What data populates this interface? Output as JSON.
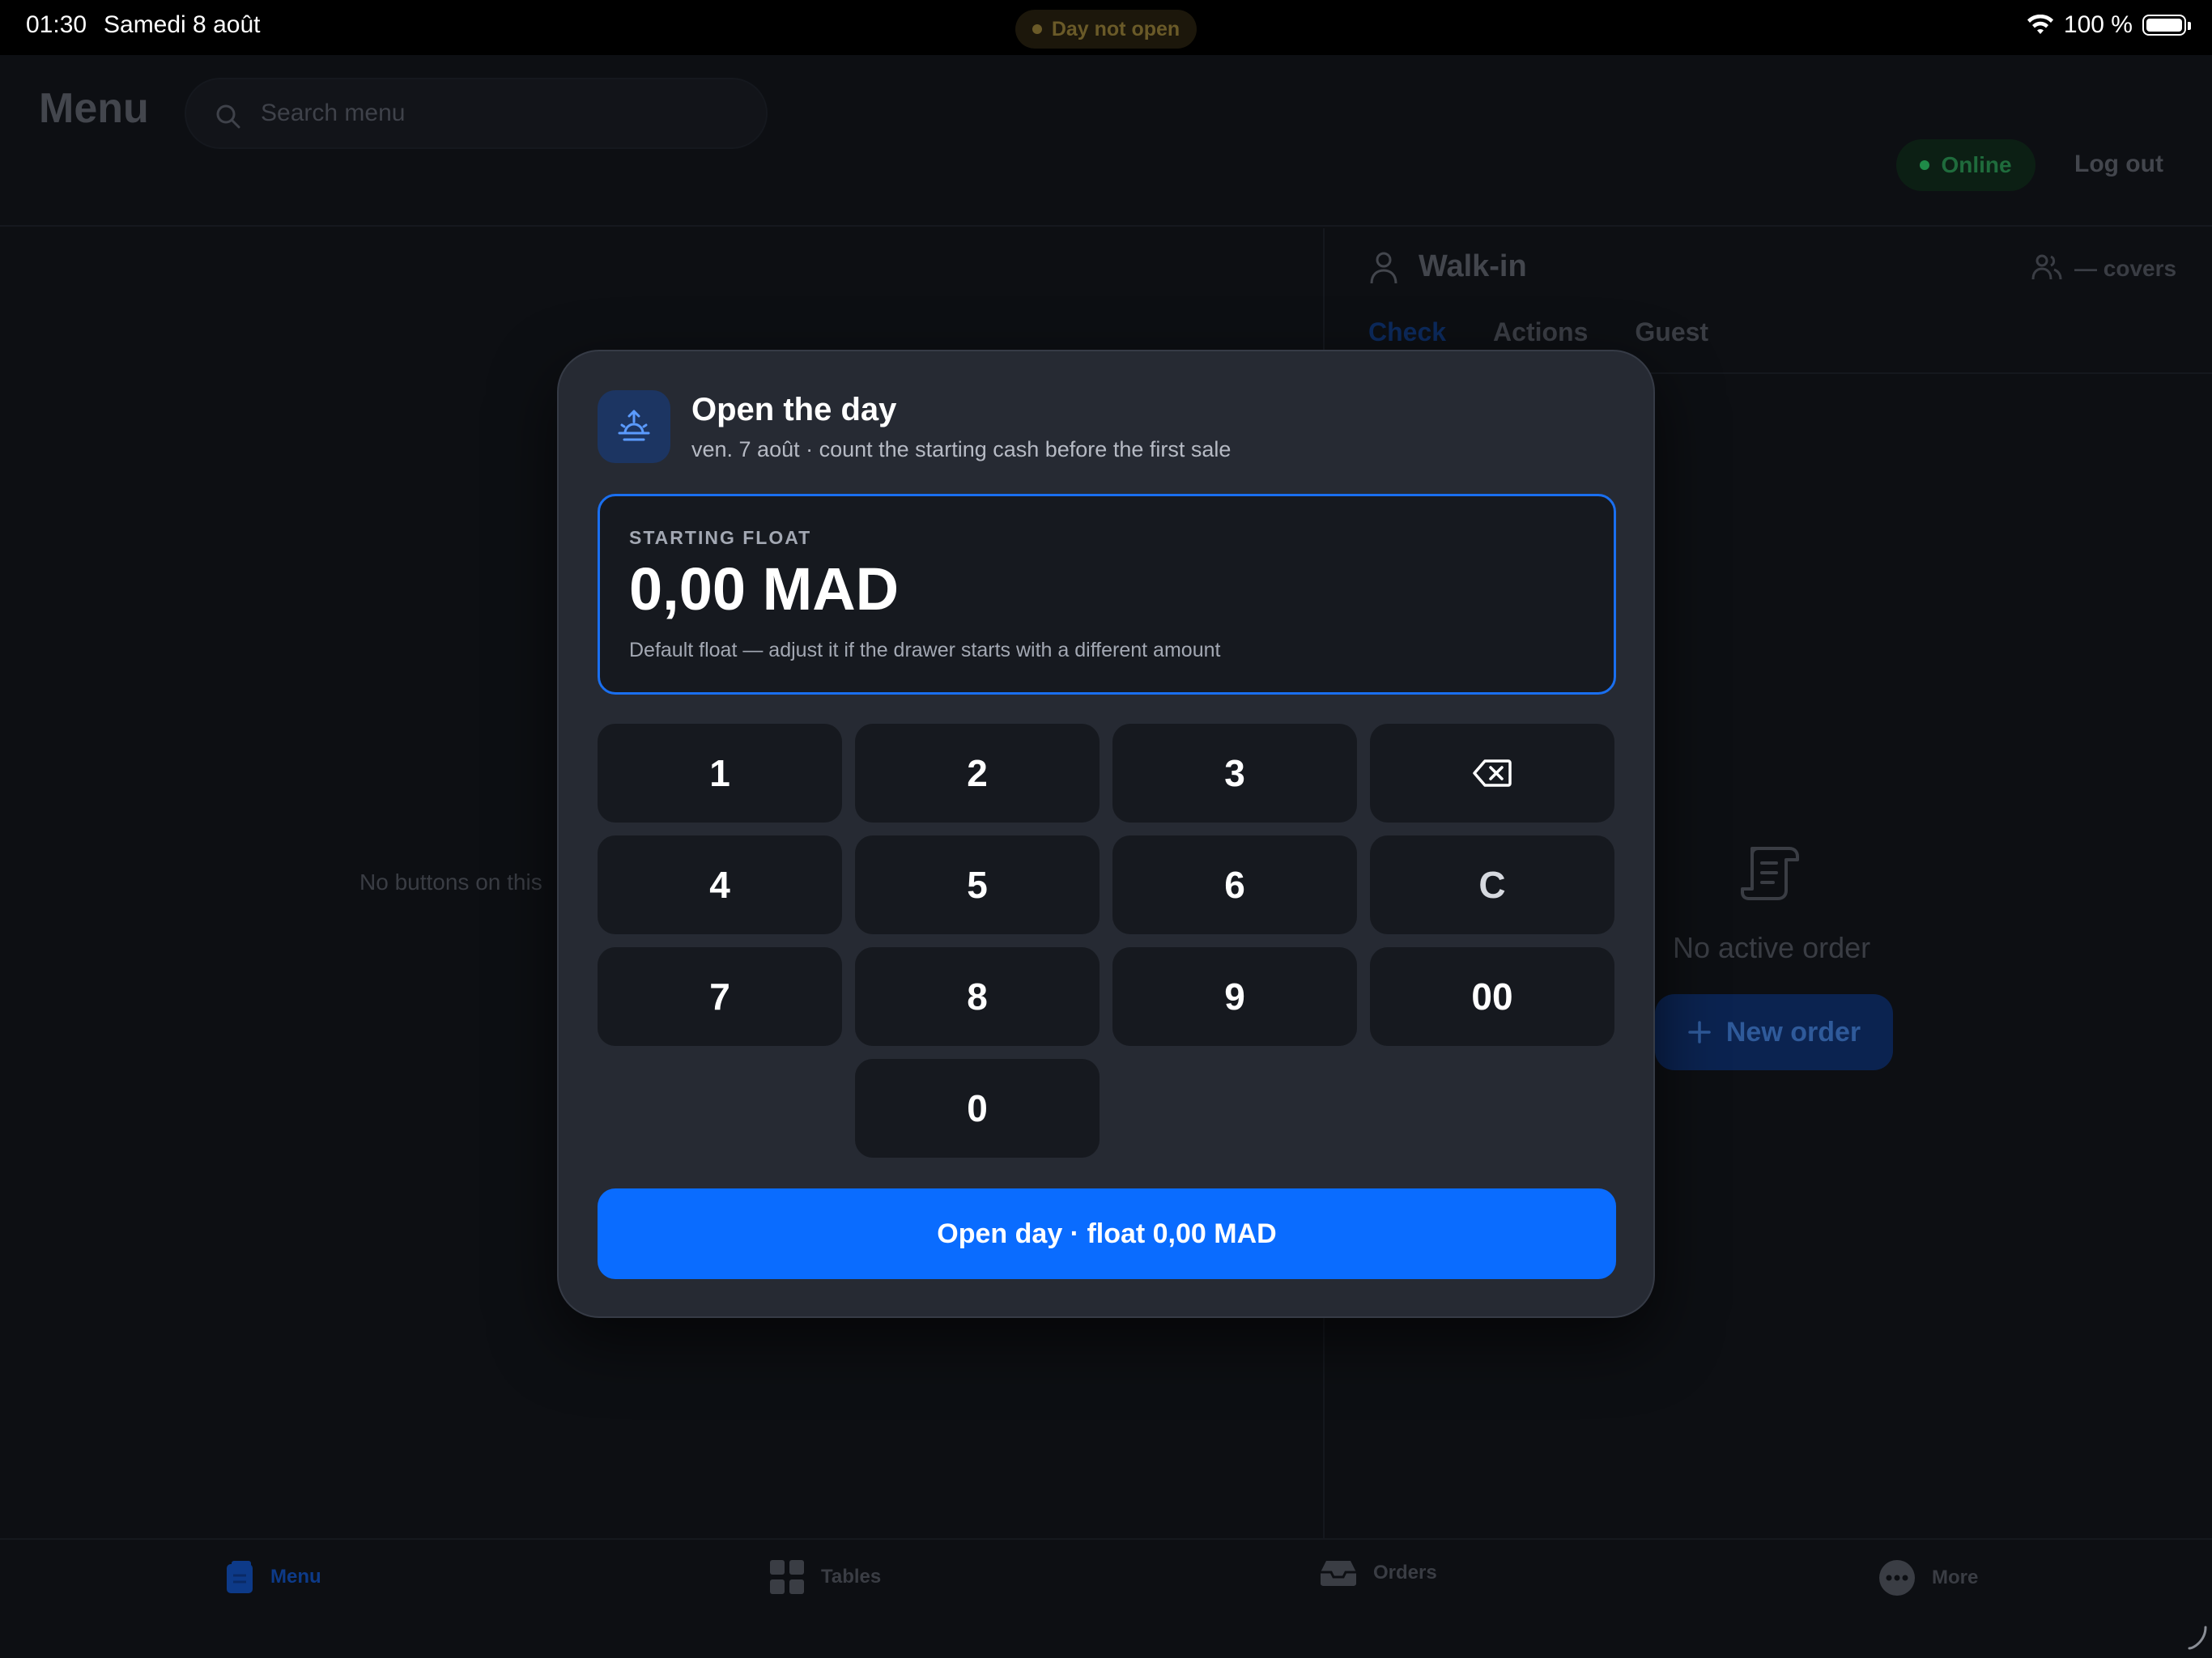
{
  "status_bar": {
    "time": "01:30",
    "date": "Samedi 8 août",
    "day_status": "Day not open",
    "battery": "100 %"
  },
  "header": {
    "title": "Menu",
    "search_placeholder": "Search menu",
    "connection": "Online",
    "logout": "Log out"
  },
  "menu": {
    "empty_text": "No buttons on this"
  },
  "order_panel": {
    "customer": "Walk-in",
    "covers": "— covers",
    "tabs": [
      "Check",
      "Actions",
      "Guest"
    ],
    "active_tab": "Check",
    "empty_text": "No active order",
    "new_order": "New order"
  },
  "bottom_nav": {
    "items": [
      {
        "label": "Menu",
        "icon": "menu-book-icon",
        "active": true
      },
      {
        "label": "Tables",
        "icon": "grid-icon",
        "active": false
      },
      {
        "label": "Orders",
        "icon": "tray-icon",
        "active": false
      },
      {
        "label": "More",
        "icon": "more-icon",
        "active": false
      }
    ]
  },
  "modal": {
    "icon": "sunrise-icon",
    "title": "Open the day",
    "subtitle": "ven. 7 août · count the starting cash before the first sale",
    "float_label": "STARTING FLOAT",
    "float_value": "0,00 MAD",
    "float_hint": "Default float — adjust it if the drawer starts with a different amount",
    "keypad": [
      "1",
      "2",
      "3",
      "⌫",
      "4",
      "5",
      "6",
      "C",
      "7",
      "8",
      "9",
      "00",
      "0"
    ],
    "primary_action": "Open day · float 0,00 MAD"
  },
  "colors": {
    "accent": "#0a6cff",
    "modal_bg": "#262a33",
    "key_bg": "#16191f",
    "background": "#0d0f13"
  }
}
